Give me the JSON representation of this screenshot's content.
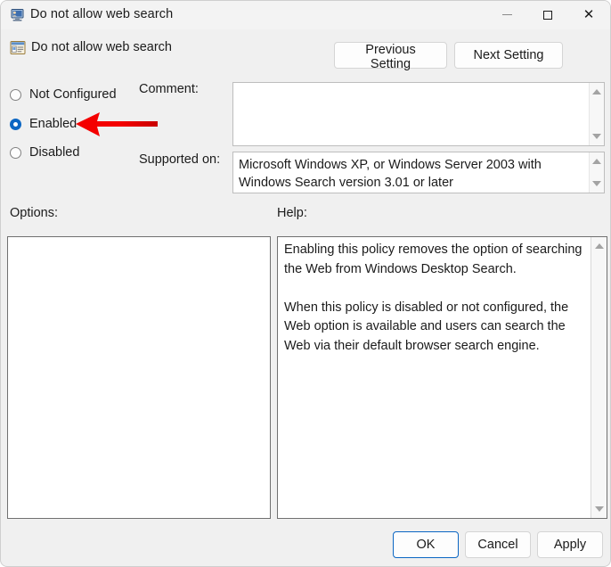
{
  "window": {
    "title": "Do not allow web search",
    "titlebar_icon": "policy-computer-icon",
    "controls": {
      "minimize_label": "—",
      "maximize_label": "□",
      "close_label": "✕"
    }
  },
  "header": {
    "policy_icon": "policy-setting-icon",
    "policy_name": "Do not allow web search",
    "previous_setting_label": "Previous Setting",
    "next_setting_label": "Next Setting"
  },
  "state_options": [
    {
      "label": "Not Configured",
      "checked": false
    },
    {
      "label": "Enabled",
      "checked": true
    },
    {
      "label": "Disabled",
      "checked": false
    }
  ],
  "comment": {
    "label": "Comment:",
    "value": ""
  },
  "supported_on": {
    "label": "Supported on:",
    "value": "Microsoft Windows XP, or Windows Server 2003 with Windows Search version 3.01 or later"
  },
  "options": {
    "label": "Options:",
    "value": ""
  },
  "help": {
    "label": "Help:",
    "text": "Enabling this policy removes the option of searching the Web from Windows Desktop Search.\n\nWhen this policy is disabled or not configured, the Web option is available and users can search the Web via their default browser search engine."
  },
  "buttons": {
    "ok_label": "OK",
    "cancel_label": "Cancel",
    "apply_label": "Apply"
  },
  "annotation": {
    "arrow_color": "#f40000",
    "points_to": "Enabled"
  },
  "colors": {
    "dialog_background": "#f0f0f0",
    "titlebar_background": "#f3f3f3",
    "accent_blue": "#0b66c3",
    "text": "#1b1b1b",
    "panel_border": "#707070",
    "annotation_red": "#f40000"
  }
}
